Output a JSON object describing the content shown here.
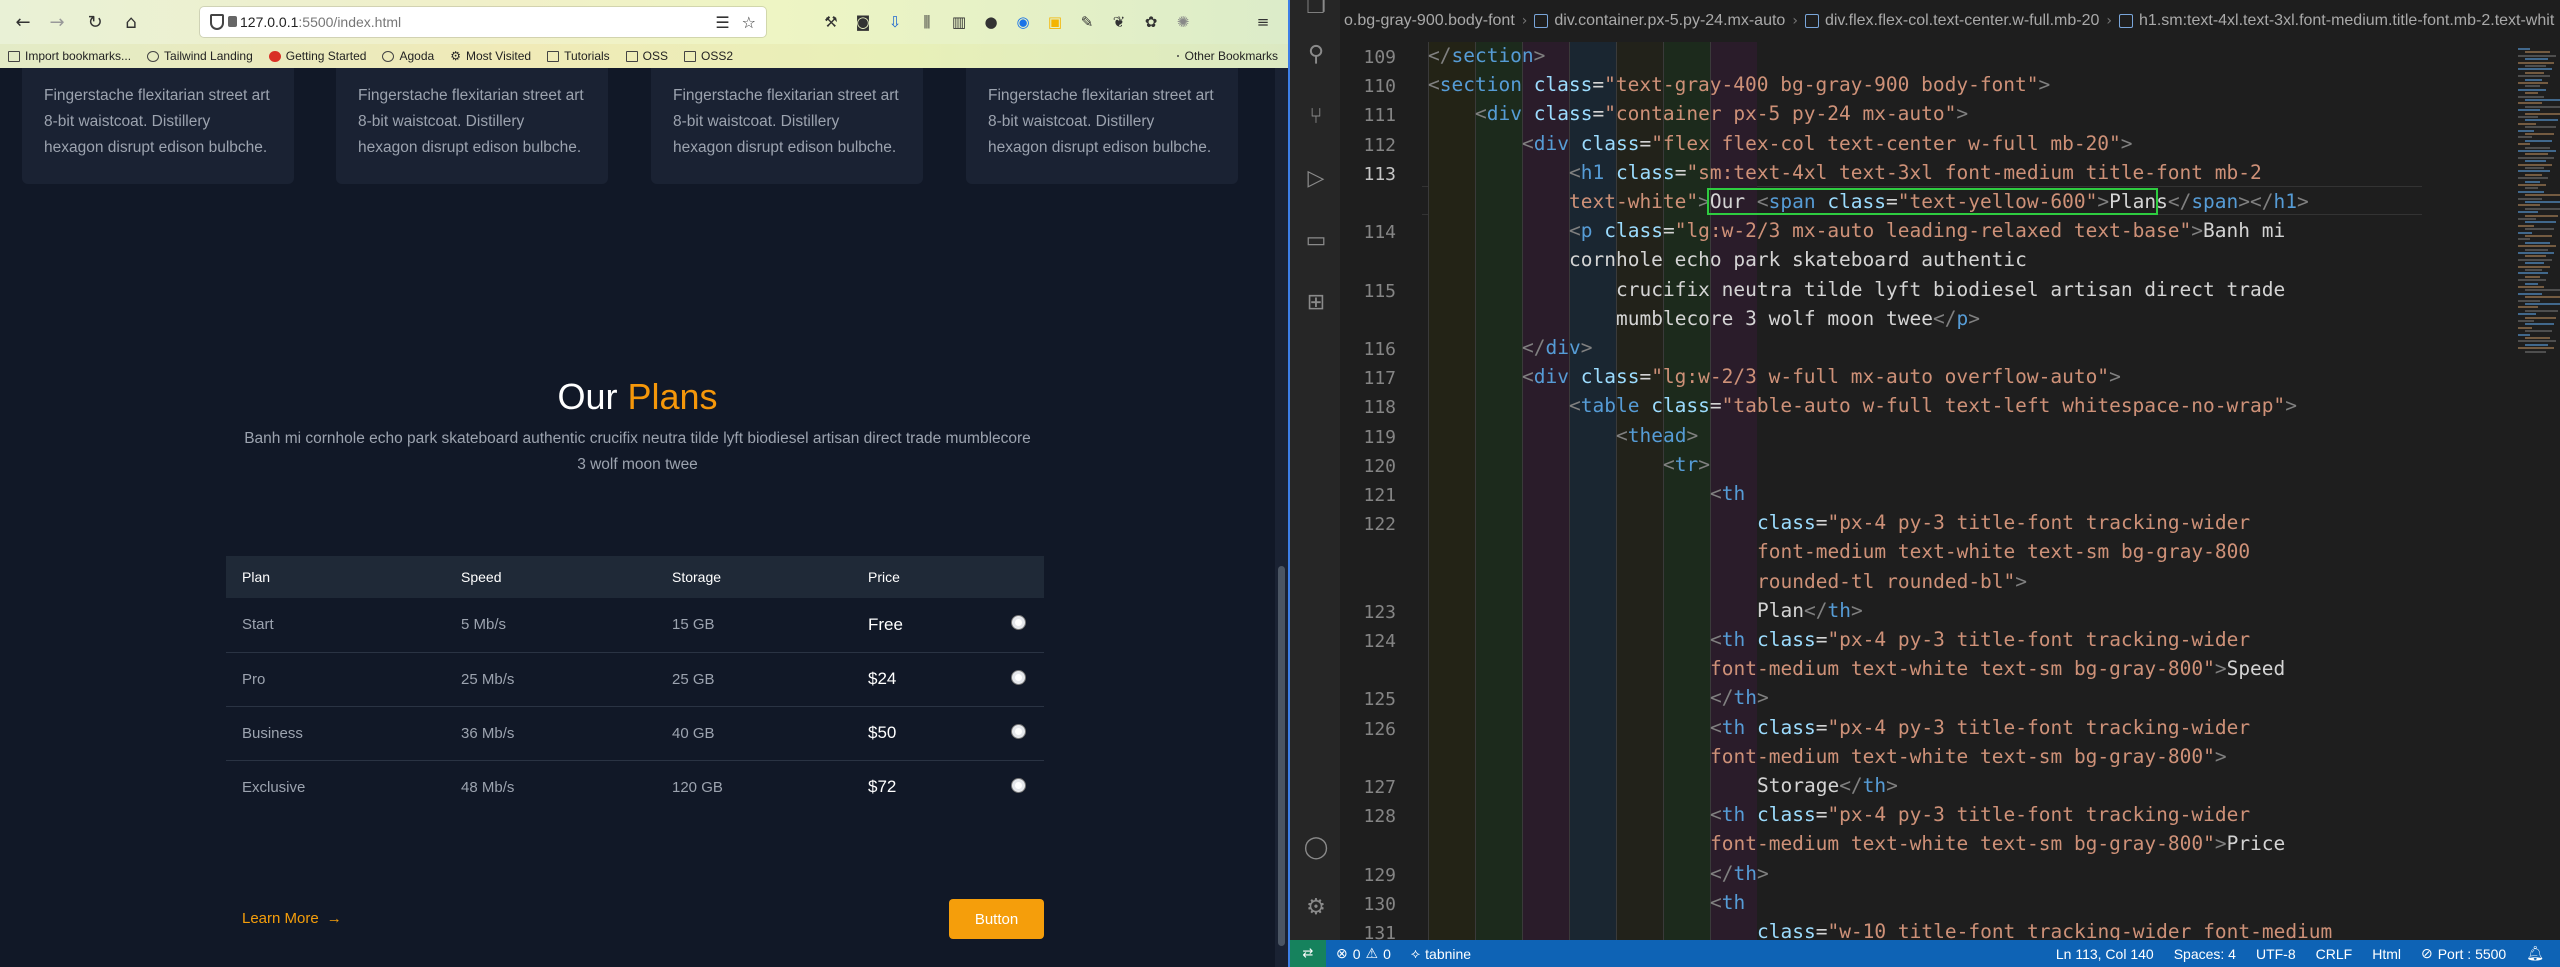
{
  "browser": {
    "url_host": "127.0.0.1",
    "url_rest": ":5500/index.html",
    "bookmarks": [
      "Import bookmarks...",
      "Tailwind Landing",
      "Getting Started",
      "Agoda",
      "Most Visited",
      "Tutorials",
      "OSS",
      "OSS2"
    ],
    "other_bookmarks": "Other Bookmarks"
  },
  "page": {
    "feature_cards": [
      {
        "line1": "Fingerstache flexitarian street art",
        "line2": "8-bit waistcoat. Distillery",
        "line3": "hexagon disrupt edison bulbche."
      },
      {
        "line1": "Fingerstache flexitarian street art",
        "line2": "8-bit waistcoat. Distillery",
        "line3": "hexagon disrupt edison bulbche."
      },
      {
        "line1": "Fingerstache flexitarian street art",
        "line2": "8-bit waistcoat. Distillery",
        "line3": "hexagon disrupt edison bulbche."
      },
      {
        "line1": "Fingerstache flexitarian street art",
        "line2": "8-bit waistcoat. Distillery",
        "line3": "hexagon disrupt edison bulbche."
      }
    ],
    "title_plain": "Our",
    "title_accent": "Plans",
    "description_line1": "Banh mi cornhole echo park skateboard authentic crucifix neutra tilde lyft biodiesel artisan direct trade mumblecore",
    "description_line2": "3 wolf moon twee",
    "table": {
      "headers": [
        "Plan",
        "Speed",
        "Storage",
        "Price"
      ],
      "rows": [
        {
          "plan": "Start",
          "speed": "5 Mb/s",
          "storage": "15 GB",
          "price": "Free"
        },
        {
          "plan": "Pro",
          "speed": "25 Mb/s",
          "storage": "25 GB",
          "price": "$24"
        },
        {
          "plan": "Business",
          "speed": "36 Mb/s",
          "storage": "40 GB",
          "price": "$50"
        },
        {
          "plan": "Exclusive",
          "speed": "48 Mb/s",
          "storage": "120 GB",
          "price": "$72"
        }
      ]
    },
    "learn_more": "Learn More",
    "learn_more_arrow": "→",
    "button_label": "Button",
    "colors": {
      "accent": "#f59e0b",
      "background": "#111827"
    }
  },
  "editor": {
    "breadcrumbs": [
      "o.bg-gray-900.body-font",
      "div.container.px-5.py-24.mx-auto",
      "div.flex.flex-col.text-center.w-full.mb-20",
      "h1.sm:text-4xl.text-3xl.font-medium.title-font.mb-2.text-whit"
    ],
    "line_numbers": [
      "109",
      "110",
      "111",
      "112",
      "113",
      "114",
      "115",
      "116",
      "117",
      "118",
      "119",
      "120",
      "121",
      "122",
      "123",
      "124",
      "125",
      "126",
      "127",
      "128",
      "129",
      "130",
      "131"
    ],
    "active_line": "113",
    "code_lines": [
      {
        "indent": 0,
        "tokens": [
          [
            "punct",
            "</"
          ],
          [
            "tag",
            "section"
          ],
          [
            "punct",
            ">"
          ]
        ]
      },
      {
        "indent": 0,
        "tokens": [
          [
            "punct",
            "<"
          ],
          [
            "tag",
            "section"
          ],
          [
            "txt",
            " "
          ],
          [
            "attr",
            "class"
          ],
          [
            "txt",
            "="
          ],
          [
            "str",
            "\"text-gray-400 bg-gray-900 body-font\""
          ],
          [
            "punct",
            ">"
          ]
        ]
      },
      {
        "indent": 1,
        "tokens": [
          [
            "punct",
            "<"
          ],
          [
            "tag",
            "div"
          ],
          [
            "txt",
            " "
          ],
          [
            "attr",
            "class"
          ],
          [
            "txt",
            "="
          ],
          [
            "str",
            "\"container px-5 py-24 mx-auto\""
          ],
          [
            "punct",
            ">"
          ]
        ]
      },
      {
        "indent": 2,
        "tokens": [
          [
            "punct",
            "<"
          ],
          [
            "tag",
            "div"
          ],
          [
            "txt",
            " "
          ],
          [
            "attr",
            "class"
          ],
          [
            "txt",
            "="
          ],
          [
            "str",
            "\"flex flex-col text-center w-full mb-20\""
          ],
          [
            "punct",
            ">"
          ]
        ]
      },
      {
        "indent": 3,
        "tokens": [
          [
            "punct",
            "<"
          ],
          [
            "tag",
            "h1"
          ],
          [
            "txt",
            " "
          ],
          [
            "attr",
            "class"
          ],
          [
            "txt",
            "="
          ],
          [
            "str",
            "\"sm:text-4xl text-3xl font-medium title-font mb-2"
          ]
        ]
      },
      {
        "indent": 3,
        "tokens": [
          [
            "str",
            "text-white\""
          ],
          [
            "punct",
            ">"
          ],
          [
            "txt",
            "Our "
          ],
          [
            "punct",
            "<"
          ],
          [
            "tag",
            "span"
          ],
          [
            "txt",
            " "
          ],
          [
            "attr",
            "class"
          ],
          [
            "txt",
            "="
          ],
          [
            "str",
            "\"text-yellow-600\""
          ],
          [
            "punct",
            ">"
          ],
          [
            "txt",
            "Plans"
          ],
          [
            "punct",
            "</"
          ],
          [
            "tag",
            "span"
          ],
          [
            "punct",
            ">"
          ],
          [
            "punct",
            "</"
          ],
          [
            "tag",
            "h1"
          ],
          [
            "punct",
            ">"
          ]
        ]
      },
      {
        "indent": 3,
        "tokens": [
          [
            "punct",
            "<"
          ],
          [
            "tag",
            "p"
          ],
          [
            "txt",
            " "
          ],
          [
            "attr",
            "class"
          ],
          [
            "txt",
            "="
          ],
          [
            "str",
            "\"lg:w-2/3 mx-auto leading-relaxed text-base\""
          ],
          [
            "punct",
            ">"
          ],
          [
            "txt",
            "Banh mi"
          ]
        ]
      },
      {
        "indent": 3,
        "tokens": [
          [
            "txt",
            "cornhole echo park skateboard authentic"
          ]
        ]
      },
      {
        "indent": 4,
        "tokens": [
          [
            "txt",
            "crucifix neutra tilde lyft biodiesel artisan direct trade"
          ]
        ]
      },
      {
        "indent": 4,
        "tokens": [
          [
            "txt",
            "mumblecore 3 wolf moon twee"
          ],
          [
            "punct",
            "</"
          ],
          [
            "tag",
            "p"
          ],
          [
            "punct",
            ">"
          ]
        ]
      },
      {
        "indent": 2,
        "tokens": [
          [
            "punct",
            "</"
          ],
          [
            "tag",
            "div"
          ],
          [
            "punct",
            ">"
          ]
        ]
      },
      {
        "indent": 2,
        "tokens": [
          [
            "punct",
            "<"
          ],
          [
            "tag",
            "div"
          ],
          [
            "txt",
            " "
          ],
          [
            "attr",
            "class"
          ],
          [
            "txt",
            "="
          ],
          [
            "str",
            "\"lg:w-2/3 w-full mx-auto overflow-auto\""
          ],
          [
            "punct",
            ">"
          ]
        ]
      },
      {
        "indent": 3,
        "tokens": [
          [
            "punct",
            "<"
          ],
          [
            "tag",
            "table"
          ],
          [
            "txt",
            " "
          ],
          [
            "attr",
            "class"
          ],
          [
            "txt",
            "="
          ],
          [
            "str",
            "\"table-auto w-full text-left whitespace-no-wrap\""
          ],
          [
            "punct",
            ">"
          ]
        ]
      },
      {
        "indent": 4,
        "tokens": [
          [
            "punct",
            "<"
          ],
          [
            "tag",
            "thead"
          ],
          [
            "punct",
            ">"
          ]
        ]
      },
      {
        "indent": 5,
        "tokens": [
          [
            "punct",
            "<"
          ],
          [
            "tag",
            "tr"
          ],
          [
            "punct",
            ">"
          ]
        ]
      },
      {
        "indent": 6,
        "tokens": [
          [
            "punct",
            "<"
          ],
          [
            "tag",
            "th"
          ]
        ]
      },
      {
        "indent": 7,
        "tokens": [
          [
            "attr",
            "class"
          ],
          [
            "txt",
            "="
          ],
          [
            "str",
            "\"px-4 py-3 title-font tracking-wider"
          ]
        ]
      },
      {
        "indent": 7,
        "tokens": [
          [
            "str",
            "font-medium text-white text-sm bg-gray-800"
          ]
        ]
      },
      {
        "indent": 7,
        "tokens": [
          [
            "str",
            "rounded-tl rounded-bl\""
          ],
          [
            "punct",
            ">"
          ]
        ]
      },
      {
        "indent": 7,
        "tokens": [
          [
            "txt",
            "Plan"
          ],
          [
            "punct",
            "</"
          ],
          [
            "tag",
            "th"
          ],
          [
            "punct",
            ">"
          ]
        ]
      },
      {
        "indent": 6,
        "tokens": [
          [
            "punct",
            "<"
          ],
          [
            "tag",
            "th"
          ],
          [
            "txt",
            " "
          ],
          [
            "attr",
            "class"
          ],
          [
            "txt",
            "="
          ],
          [
            "str",
            "\"px-4 py-3 title-font tracking-wider"
          ]
        ]
      },
      {
        "indent": 6,
        "tokens": [
          [
            "str",
            "font-medium text-white text-sm bg-gray-800\""
          ],
          [
            "punct",
            ">"
          ],
          [
            "txt",
            "Speed"
          ]
        ]
      },
      {
        "indent": 6,
        "tokens": [
          [
            "punct",
            "</"
          ],
          [
            "tag",
            "th"
          ],
          [
            "punct",
            ">"
          ]
        ]
      },
      {
        "indent": 6,
        "tokens": [
          [
            "punct",
            "<"
          ],
          [
            "tag",
            "th"
          ],
          [
            "txt",
            " "
          ],
          [
            "attr",
            "class"
          ],
          [
            "txt",
            "="
          ],
          [
            "str",
            "\"px-4 py-3 title-font tracking-wider"
          ]
        ]
      },
      {
        "indent": 6,
        "tokens": [
          [
            "str",
            "font-medium text-white text-sm bg-gray-800\""
          ],
          [
            "punct",
            ">"
          ]
        ]
      },
      {
        "indent": 7,
        "tokens": [
          [
            "txt",
            "Storage"
          ],
          [
            "punct",
            "</"
          ],
          [
            "tag",
            "th"
          ],
          [
            "punct",
            ">"
          ]
        ]
      },
      {
        "indent": 6,
        "tokens": [
          [
            "punct",
            "<"
          ],
          [
            "tag",
            "th"
          ],
          [
            "txt",
            " "
          ],
          [
            "attr",
            "class"
          ],
          [
            "txt",
            "="
          ],
          [
            "str",
            "\"px-4 py-3 title-font tracking-wider"
          ]
        ]
      },
      {
        "indent": 6,
        "tokens": [
          [
            "str",
            "font-medium text-white text-sm bg-gray-800\""
          ],
          [
            "punct",
            ">"
          ],
          [
            "txt",
            "Price"
          ]
        ]
      },
      {
        "indent": 6,
        "tokens": [
          [
            "punct",
            "</"
          ],
          [
            "tag",
            "th"
          ],
          [
            "punct",
            ">"
          ]
        ]
      },
      {
        "indent": 6,
        "tokens": [
          [
            "punct",
            "<"
          ],
          [
            "tag",
            "th"
          ]
        ]
      },
      {
        "indent": 7,
        "tokens": [
          [
            "attr",
            "class"
          ],
          [
            "txt",
            "="
          ],
          [
            "str",
            "\"w-10 title-font tracking-wider font-medium"
          ]
        ]
      }
    ],
    "status": {
      "errors": "0",
      "warnings": "0",
      "tabnine": "tabnine",
      "position": "Ln 113, Col 140",
      "spaces": "Spaces: 4",
      "encoding": "UTF-8",
      "eol": "CRLF",
      "language": "Html",
      "port": "Port : 5500"
    }
  }
}
